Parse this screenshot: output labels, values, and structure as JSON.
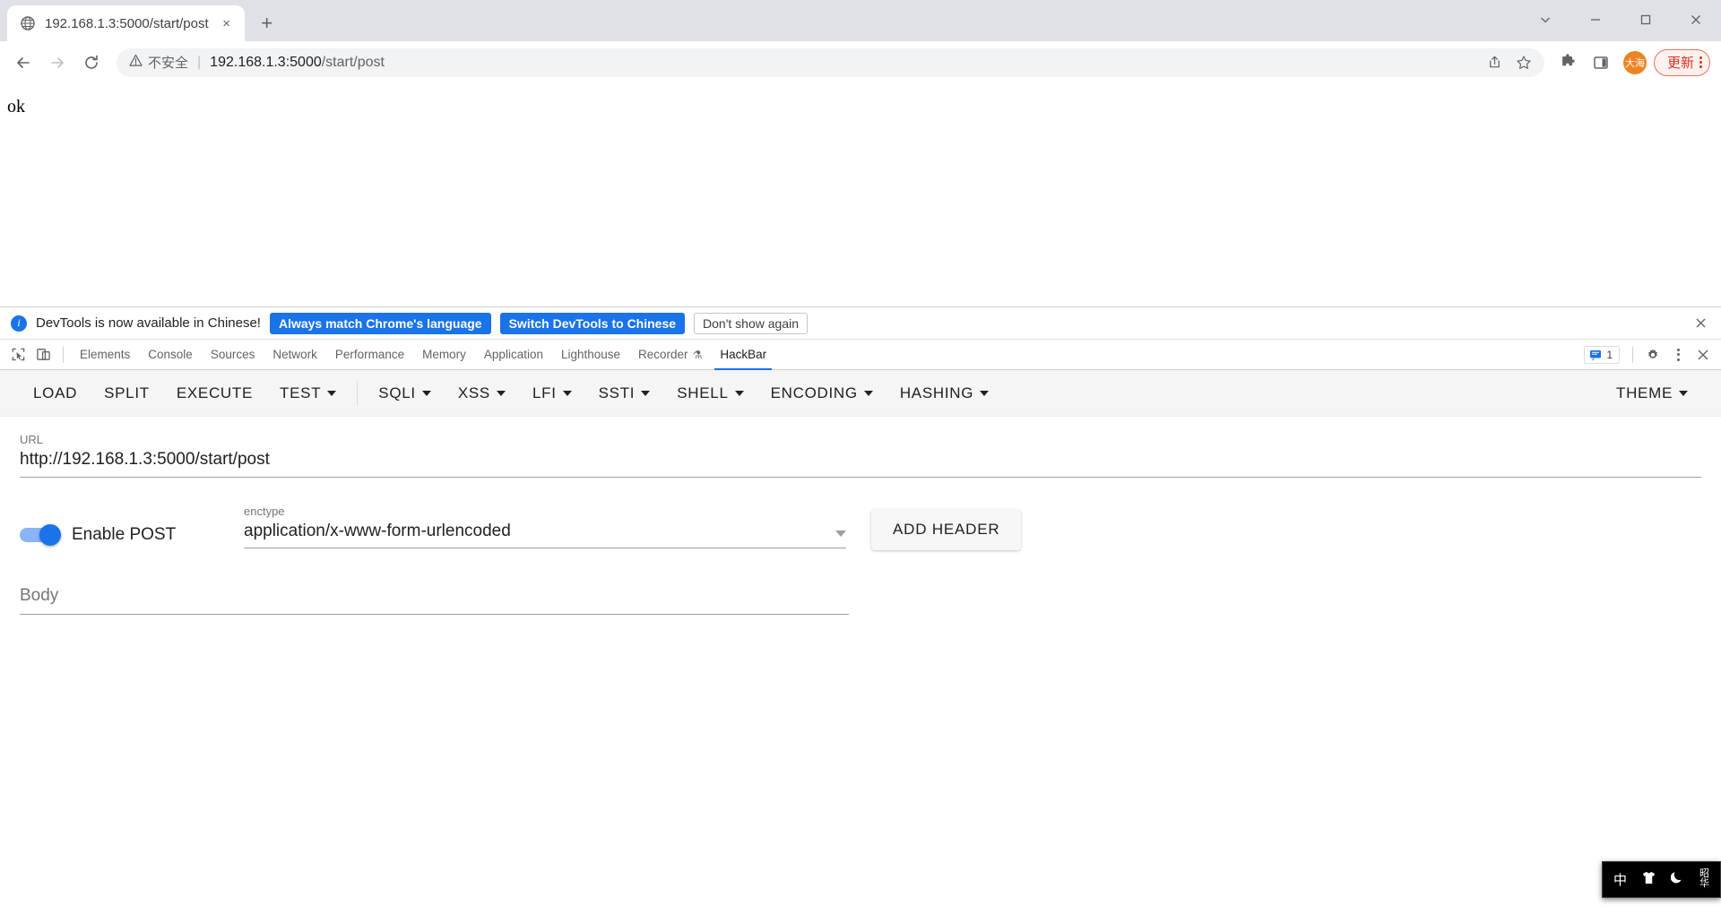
{
  "browser": {
    "tab": {
      "title": "192.168.1.3:5000/start/post",
      "favicon": "globe-icon",
      "close": "×"
    },
    "new_tab": "+",
    "window_controls": {
      "expand": "⌄",
      "minimize": "—",
      "maximize": "□",
      "close": "×"
    },
    "nav": {
      "back": "←",
      "forward": "→",
      "reload": "↻"
    },
    "omnibox": {
      "security_icon": "warning-triangle-icon",
      "security_text": "不安全",
      "separator": "|",
      "url_host": "192.168.1.3:5000",
      "url_path": "/start/post",
      "full_url": "192.168.1.3:5000/start/post",
      "share_icon": "share-icon",
      "bookmark_icon": "star-icon"
    },
    "extensions_icon": "puzzle-icon",
    "sidepanel_icon": "side-panel-icon",
    "avatar_text": "大海",
    "update_button": "更新",
    "menu_icon": "kebab-menu-icon",
    "accent_orange": "#ec8424",
    "accent_red": "#d93025"
  },
  "page": {
    "content": "ok"
  },
  "devtools": {
    "banner": {
      "info_icon": "info-icon",
      "message": "DevTools is now available in Chinese!",
      "primary_button": "Always match Chrome's language",
      "secondary_button": "Switch DevTools to Chinese",
      "dismiss_button": "Don't show again",
      "close_icon": "×",
      "blue": "#1a73e8"
    },
    "inspect_icon": "inspect-element-icon",
    "device_icon": "device-toolbar-icon",
    "tabs": [
      {
        "label": "Elements",
        "active": false
      },
      {
        "label": "Console",
        "active": false
      },
      {
        "label": "Sources",
        "active": false
      },
      {
        "label": "Network",
        "active": false
      },
      {
        "label": "Performance",
        "active": false
      },
      {
        "label": "Memory",
        "active": false
      },
      {
        "label": "Application",
        "active": false
      },
      {
        "label": "Lighthouse",
        "active": false
      },
      {
        "label": "Recorder",
        "active": false,
        "badge": "⚗"
      },
      {
        "label": "HackBar",
        "active": true
      }
    ],
    "message_count": "1",
    "message_icon": "message-icon",
    "settings_icon": "gear-icon",
    "more_icon": "kebab-menu-icon",
    "close_icon": "×"
  },
  "hackbar": {
    "toolbar": [
      {
        "label": "LOAD",
        "dropdown": false
      },
      {
        "label": "SPLIT",
        "dropdown": false
      },
      {
        "label": "EXECUTE",
        "dropdown": false
      },
      {
        "label": "TEST",
        "dropdown": true
      }
    ],
    "toolbar2": [
      {
        "label": "SQLI",
        "dropdown": true
      },
      {
        "label": "XSS",
        "dropdown": true
      },
      {
        "label": "LFI",
        "dropdown": true
      },
      {
        "label": "SSTI",
        "dropdown": true
      },
      {
        "label": "SHELL",
        "dropdown": true
      },
      {
        "label": "ENCODING",
        "dropdown": true
      },
      {
        "label": "HASHING",
        "dropdown": true
      }
    ],
    "theme": {
      "label": "THEME",
      "dropdown": true
    },
    "url_field": {
      "label": "URL",
      "value": "http://192.168.1.3:5000/start/post"
    },
    "post_toggle": {
      "label": "Enable POST",
      "enabled": true
    },
    "enctype_field": {
      "label": "enctype",
      "value": "application/x-www-form-urlencoded"
    },
    "add_header_button": "ADD HEADER",
    "body_field": {
      "placeholder": "Body",
      "value": ""
    }
  },
  "ime": {
    "mode": "中",
    "shirt_icon": "shirt-icon",
    "moon_icon": "moon-icon",
    "label_top": "昭",
    "label_bottom": "华"
  }
}
